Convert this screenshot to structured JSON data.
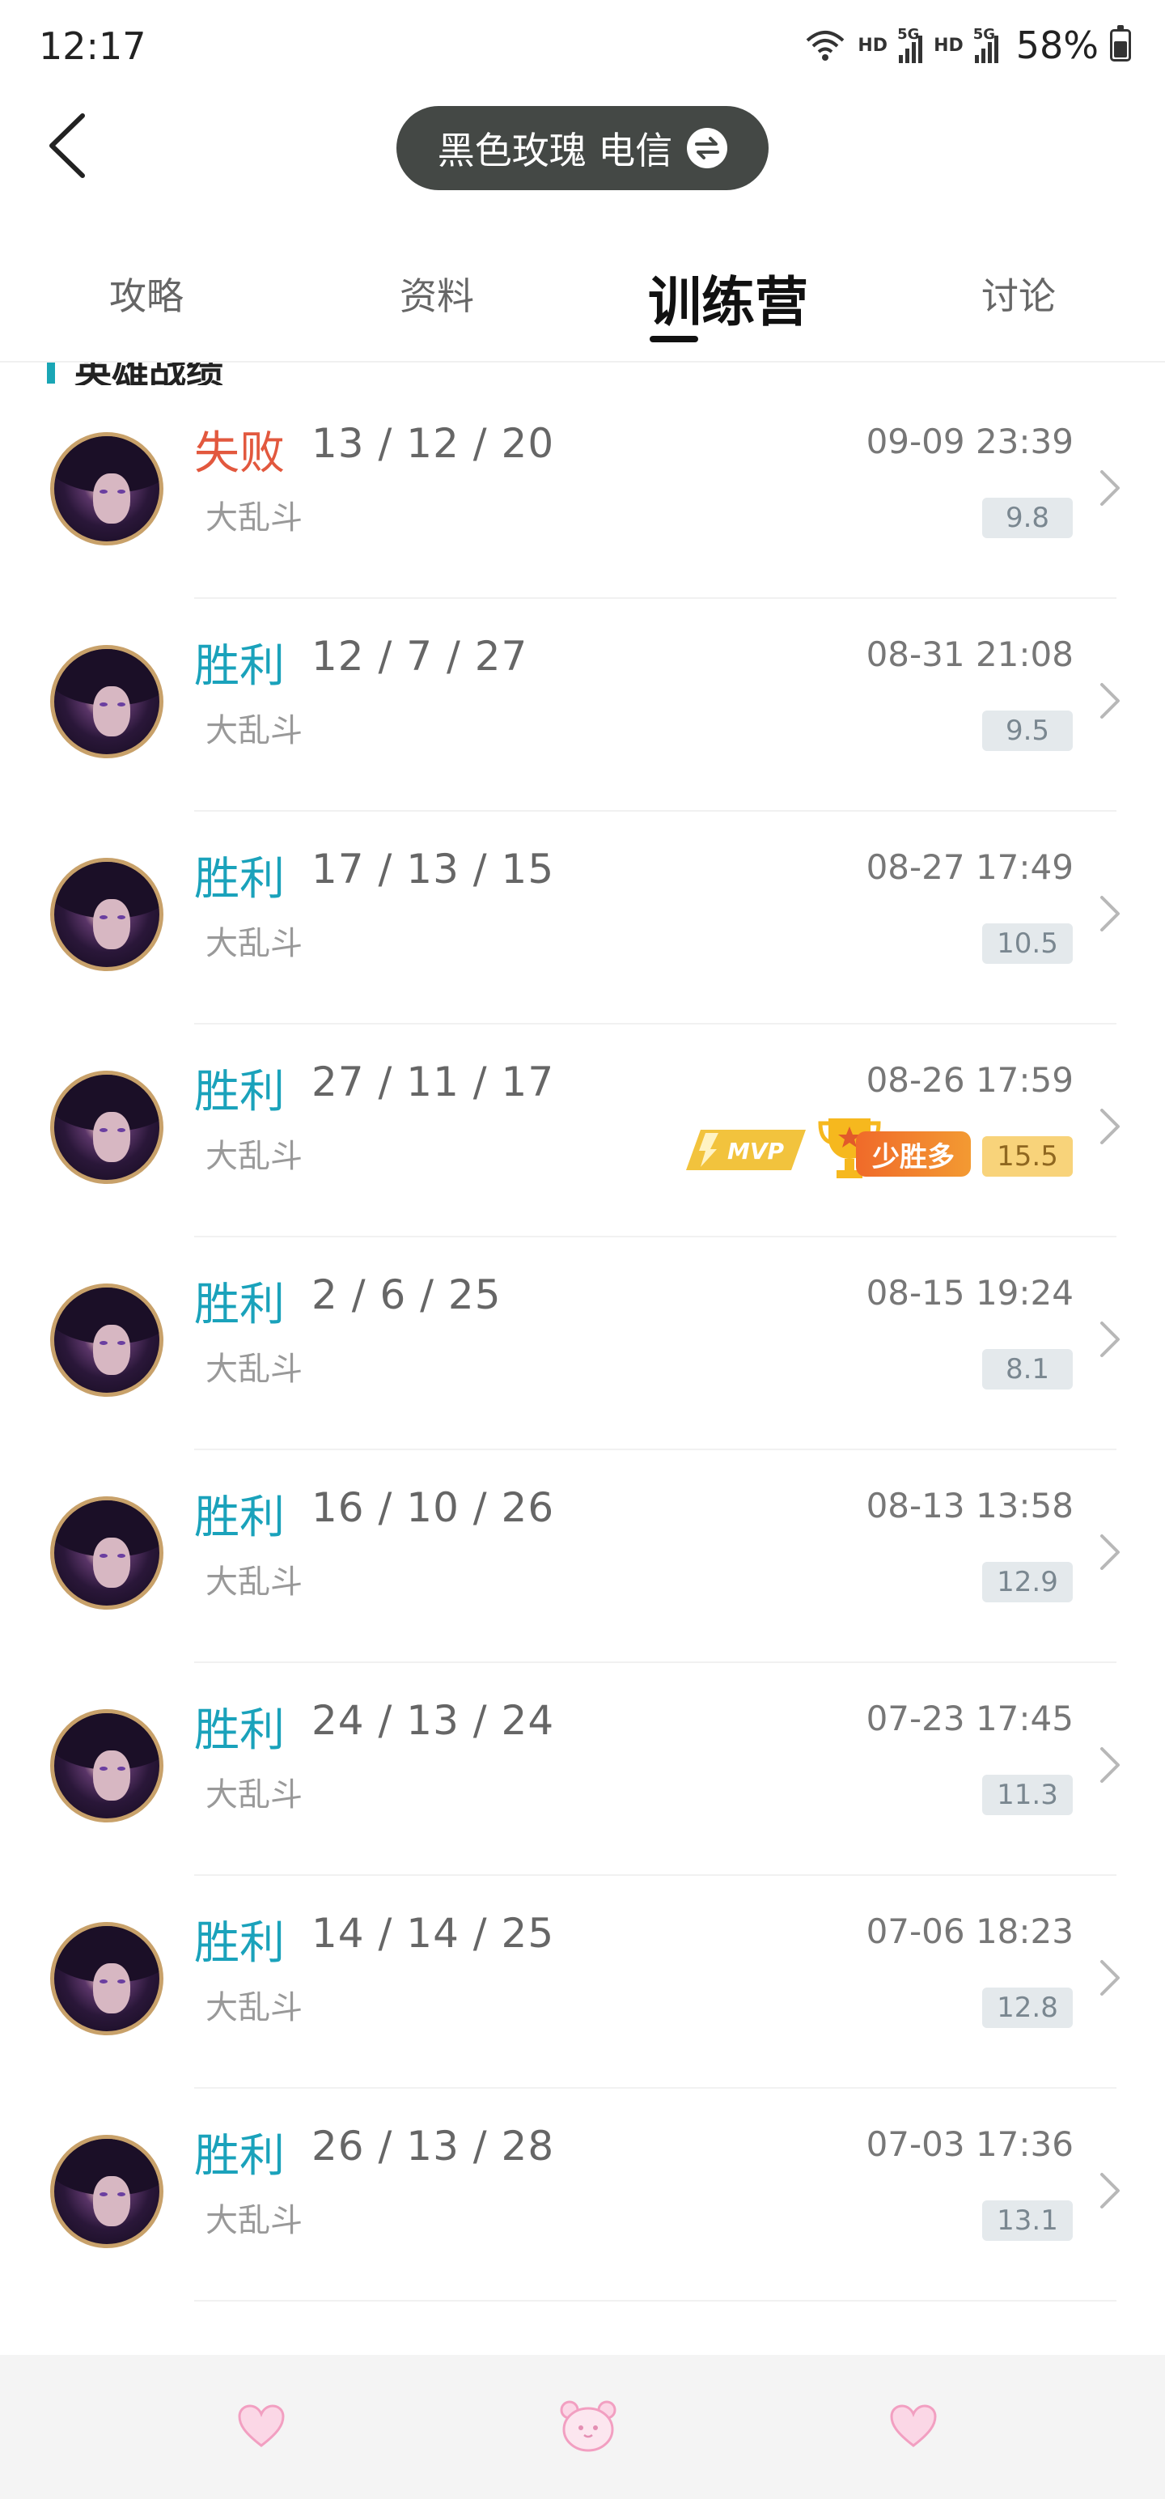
{
  "status_bar": {
    "time": "12:17",
    "hd1": "HD",
    "net1": "5G",
    "hd2": "HD",
    "net2": "5G",
    "battery_pct": "58%",
    "battery_level": 0.58
  },
  "header": {
    "account_name": "黑色玫瑰 电信"
  },
  "tabs": [
    {
      "label": "攻略",
      "active": false
    },
    {
      "label": "资料",
      "active": false
    },
    {
      "label": "训练营",
      "active": true
    },
    {
      "label": "讨论",
      "active": false
    }
  ],
  "section": {
    "title": "英雄战绩"
  },
  "matches": [
    {
      "result": "失败",
      "outcome": "loss",
      "kda": "13 / 12 / 20",
      "datetime": "09-09 23:39",
      "mode": "大乱斗",
      "score": "9.8",
      "mvp": false,
      "few_wins": false
    },
    {
      "result": "胜利",
      "outcome": "win",
      "kda": "12 / 7 / 27",
      "datetime": "08-31 21:08",
      "mode": "大乱斗",
      "score": "9.5",
      "mvp": false,
      "few_wins": false
    },
    {
      "result": "胜利",
      "outcome": "win",
      "kda": "17 / 13 / 15",
      "datetime": "08-27 17:49",
      "mode": "大乱斗",
      "score": "10.5",
      "mvp": false,
      "few_wins": false
    },
    {
      "result": "胜利",
      "outcome": "win",
      "kda": "27 / 11 / 17",
      "datetime": "08-26 17:59",
      "mode": "大乱斗",
      "score": "15.5",
      "mvp": true,
      "mvp_label": "MVP",
      "few_wins": true,
      "few_wins_label": "少胜多"
    },
    {
      "result": "胜利",
      "outcome": "win",
      "kda": "2 / 6 / 25",
      "datetime": "08-15 19:24",
      "mode": "大乱斗",
      "score": "8.1",
      "mvp": false,
      "few_wins": false
    },
    {
      "result": "胜利",
      "outcome": "win",
      "kda": "16 / 10 / 26",
      "datetime": "08-13 13:58",
      "mode": "大乱斗",
      "score": "12.9",
      "mvp": false,
      "few_wins": false
    },
    {
      "result": "胜利",
      "outcome": "win",
      "kda": "24 / 13 / 24",
      "datetime": "07-23 17:45",
      "mode": "大乱斗",
      "score": "11.3",
      "mvp": false,
      "few_wins": false
    },
    {
      "result": "胜利",
      "outcome": "win",
      "kda": "14 / 14 / 25",
      "datetime": "07-06 18:23",
      "mode": "大乱斗",
      "score": "12.8",
      "mvp": false,
      "few_wins": false
    },
    {
      "result": "胜利",
      "outcome": "win",
      "kda": "26 / 13 / 28",
      "datetime": "07-03 17:36",
      "mode": "大乱斗",
      "score": "13.1",
      "mvp": false,
      "few_wins": false
    }
  ],
  "colors": {
    "win": "#1aa2bb",
    "loss": "#e2583e",
    "accent_bar": "#1aa6b5",
    "score_gold": "#f8d37a"
  },
  "bottom_bar": {
    "icons": [
      "heart-icon",
      "bear-icon",
      "heart-icon"
    ]
  }
}
